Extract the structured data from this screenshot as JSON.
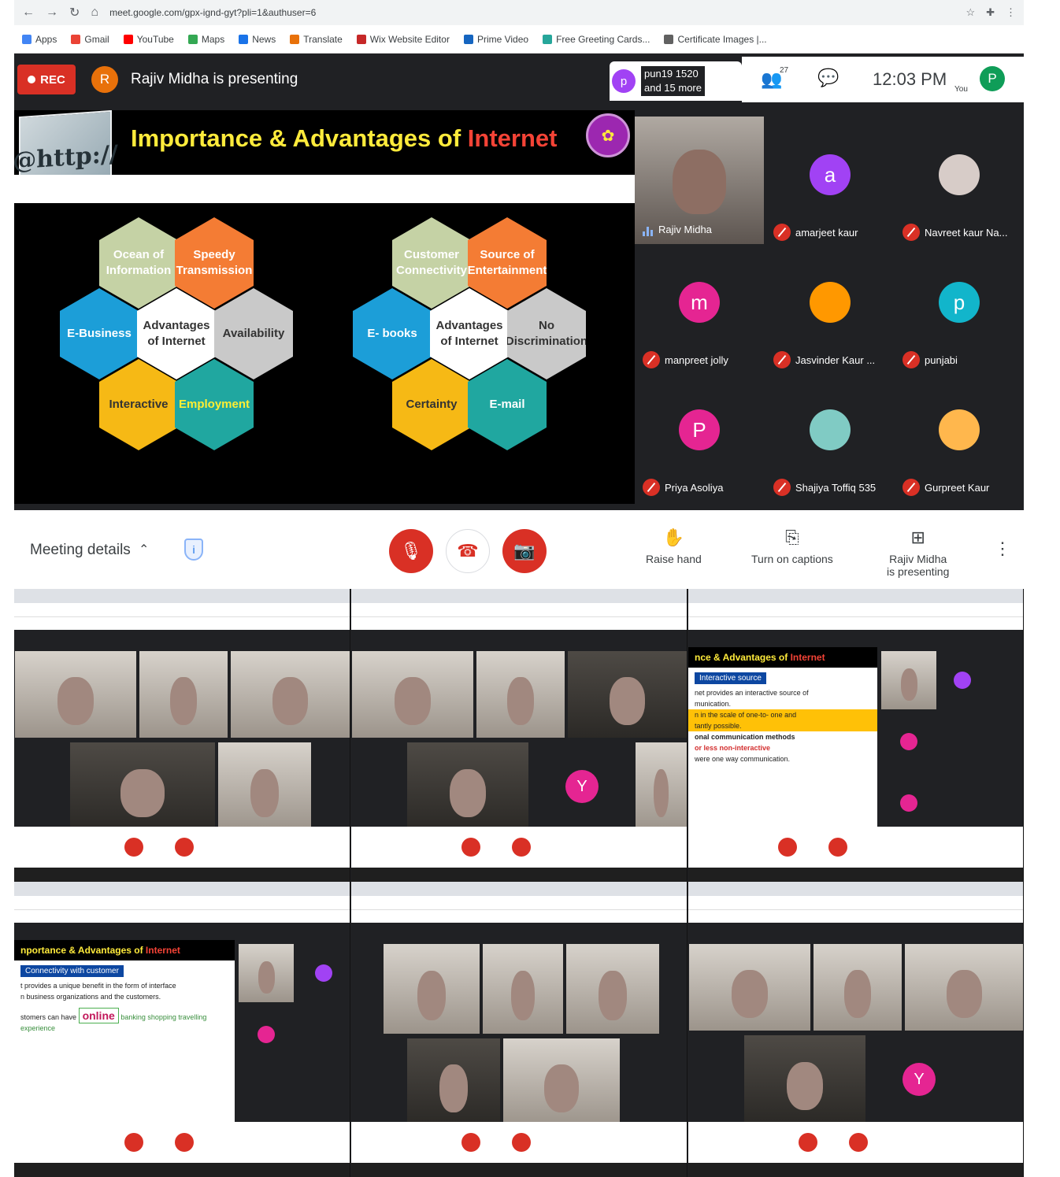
{
  "browser": {
    "url": "meet.google.com/gpx-ignd-gyt?pli=1&authuser=6",
    "bookmarks": [
      "Apps",
      "Gmail",
      "YouTube",
      "Maps",
      "News",
      "Translate",
      "Wix Website Editor",
      "Prime Video",
      "Free Greeting Cards...",
      "Certificate Images |..."
    ]
  },
  "meet": {
    "rec_label": "REC",
    "presenter_initial": "R",
    "presenter_text": "Rajiv Midha is presenting",
    "pill_initial": "p",
    "pill_text_line1": "pun19 1520",
    "pill_text_line2": "and 15 more",
    "people_count": "27",
    "time": "12:03 PM",
    "you_label": "You",
    "you_initial": "P"
  },
  "slide": {
    "logo_text": "@http://",
    "title_part1": "Importance  &  Advantages of ",
    "title_part2": "Internet",
    "left_cluster": {
      "center": "Advantages of Internet",
      "top_left": "Ocean of Information",
      "top_right": "Speedy Transmission",
      "left": "E-Business",
      "right": "Availability",
      "bottom_left": "Interactive",
      "bottom_right": "Employment"
    },
    "right_cluster": {
      "center": "Advantages of Internet",
      "top_left": "Customer Connectivity",
      "top_right": "Source of Entertainment",
      "left": "E- books",
      "right": "No Discrimination",
      "bottom_left": "Certainty",
      "bottom_right": "E-mail"
    }
  },
  "participants": [
    {
      "name": "Rajiv Midha",
      "initial": "",
      "color": "",
      "video": true
    },
    {
      "name": "amarjeet kaur",
      "initial": "a",
      "color": "#a142f4",
      "video": false
    },
    {
      "name": "Navreet kaur Na...",
      "initial": "",
      "color": "#d7ccc8",
      "video": false
    },
    {
      "name": "manpreet jolly",
      "initial": "m",
      "color": "#e52592",
      "video": false
    },
    {
      "name": "Jasvinder Kaur ...",
      "initial": "",
      "color": "#ff9800",
      "video": false
    },
    {
      "name": "punjabi",
      "initial": "p",
      "color": "#12b5cb",
      "video": false
    },
    {
      "name": "Priya Asoliya",
      "initial": "P",
      "color": "#e52592",
      "video": false
    },
    {
      "name": "Shajiya Toffiq 535",
      "initial": "",
      "color": "#80cbc4",
      "video": false
    },
    {
      "name": "Gurpreet Kaur",
      "initial": "",
      "color": "#ffb74d",
      "video": false
    }
  ],
  "controls": {
    "meeting_details": "Meeting details",
    "raise_hand": "Raise hand",
    "captions": "Turn on captions",
    "presenting_line1": "Rajiv Midha",
    "presenting_line2": "is presenting"
  },
  "thumbs": {
    "t3_title1": "nce  &  Advantages of ",
    "t3_title2": "Internet",
    "t3_tag": "Interactive source",
    "t3_line1": "net provides an interactive source of",
    "t3_line2": "munication.",
    "t3_line3": "n in the scale of one-to- one and",
    "t3_line4": "tantly possible.",
    "t3_line5": "onal communication methods",
    "t3_line6": "or less non-interactive",
    "t3_line7": "were one way communication.",
    "t4_title1": "nportance  &  Advantages of ",
    "t4_title2": "Internet",
    "t4_tag": "Connectivity with customer",
    "t4_line1": "t provides a unique benefit in the form of interface",
    "t4_line2": "n business organizations and the customers.",
    "t4_line3": "stomers can have",
    "t4_online": "online",
    "t4_items": "banking shopping travelling experience",
    "y_initial": "Y"
  }
}
